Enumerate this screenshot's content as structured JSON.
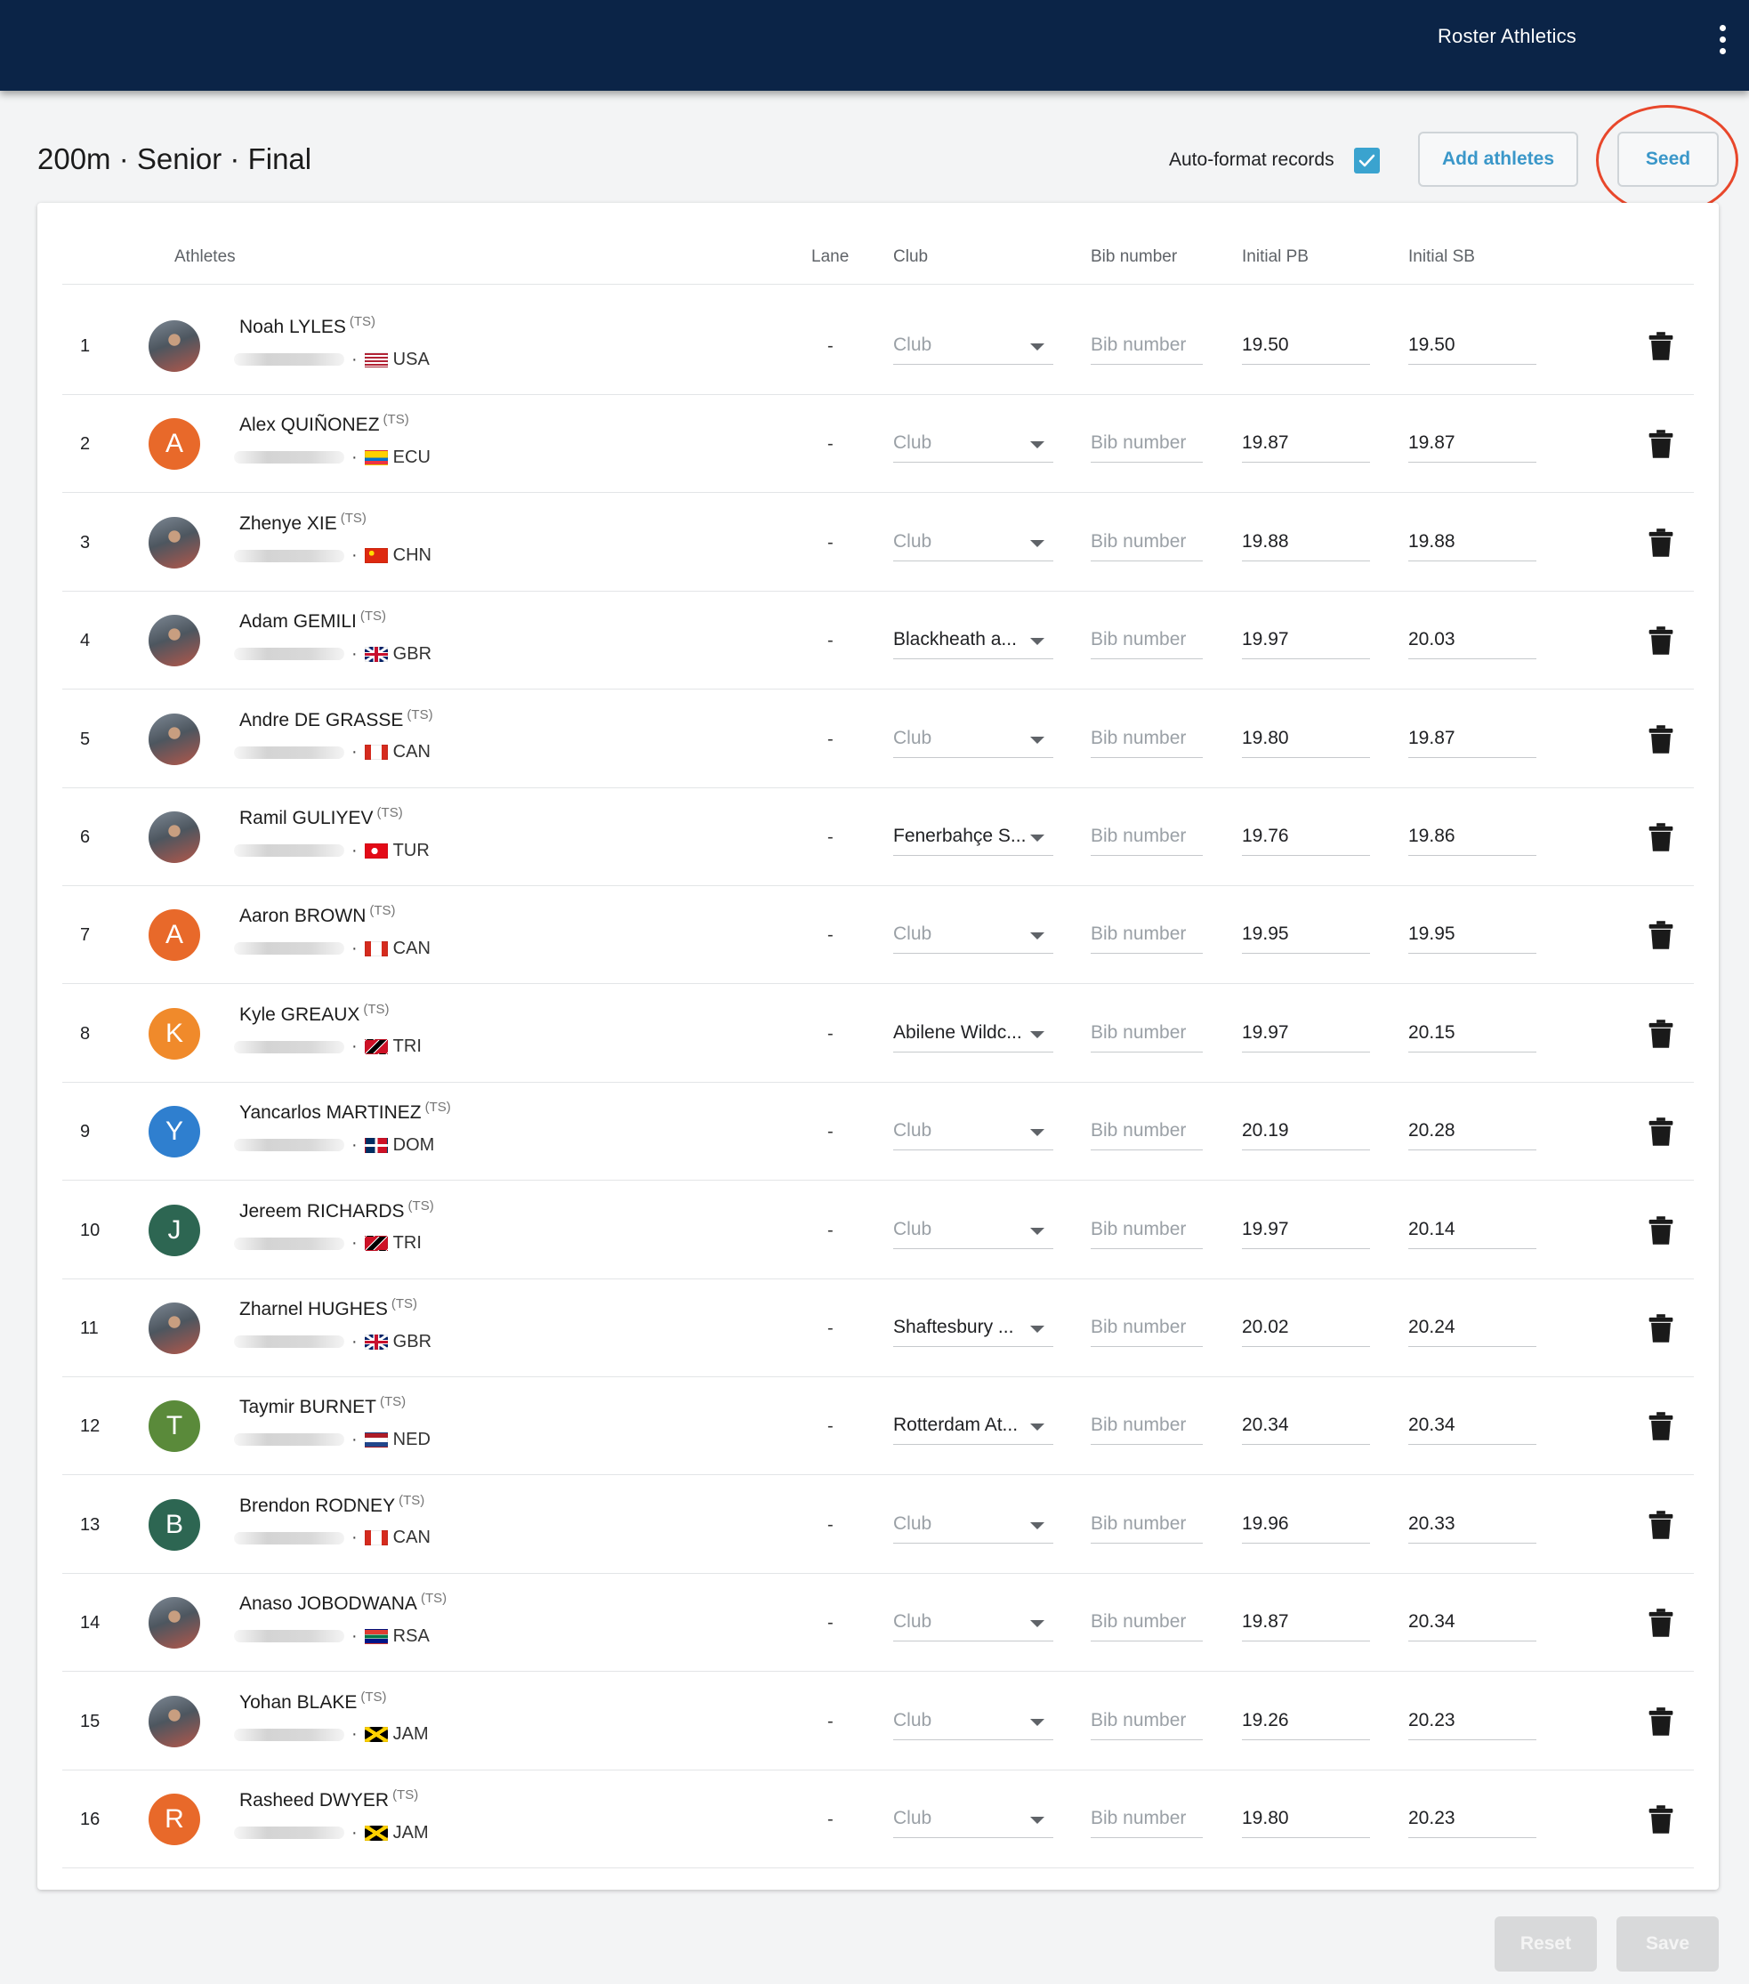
{
  "app": {
    "title": "Roster Athletics"
  },
  "page": {
    "title": "200m · Senior · Final",
    "autoformat_label": "Auto-format records",
    "autoformat_checked": true,
    "add_athletes_label": "Add athletes",
    "seed_label": "Seed",
    "reset_label": "Reset",
    "save_label": "Save"
  },
  "table": {
    "headers": {
      "athletes": "Athletes",
      "lane": "Lane",
      "club": "Club",
      "bib": "Bib number",
      "pb": "Initial PB",
      "sb": "Initial SB"
    },
    "club_placeholder": "Club",
    "bib_placeholder": "Bib number",
    "ts_tag": "(TS)",
    "rows": [
      {
        "index": "1",
        "name": "Noah LYLES",
        "country": "USA",
        "flag": "usa",
        "avatar_type": "photo",
        "avatar_letter": "",
        "avatar_color": "",
        "lane": "-",
        "club": "",
        "bib": "",
        "pb": "19.50",
        "sb": "19.50"
      },
      {
        "index": "2",
        "name": "Alex QUIÑONEZ",
        "country": "ECU",
        "flag": "ecu",
        "avatar_type": "letter",
        "avatar_letter": "A",
        "avatar_color": "#e8692a",
        "lane": "-",
        "club": "",
        "bib": "",
        "pb": "19.87",
        "sb": "19.87"
      },
      {
        "index": "3",
        "name": "Zhenye XIE",
        "country": "CHN",
        "flag": "chn",
        "avatar_type": "photo",
        "avatar_letter": "",
        "avatar_color": "",
        "lane": "-",
        "club": "",
        "bib": "",
        "pb": "19.88",
        "sb": "19.88"
      },
      {
        "index": "4",
        "name": "Adam GEMILI",
        "country": "GBR",
        "flag": "gbr",
        "avatar_type": "photo",
        "avatar_letter": "",
        "avatar_color": "",
        "lane": "-",
        "club": "Blackheath a...",
        "bib": "",
        "pb": "19.97",
        "sb": "20.03"
      },
      {
        "index": "5",
        "name": "Andre DE GRASSE",
        "country": "CAN",
        "flag": "can",
        "avatar_type": "photo",
        "avatar_letter": "",
        "avatar_color": "",
        "lane": "-",
        "club": "",
        "bib": "",
        "pb": "19.80",
        "sb": "19.87"
      },
      {
        "index": "6",
        "name": "Ramil GULIYEV",
        "country": "TUR",
        "flag": "tur",
        "avatar_type": "photo",
        "avatar_letter": "",
        "avatar_color": "",
        "lane": "-",
        "club": "Fenerbahçe S...",
        "bib": "",
        "pb": "19.76",
        "sb": "19.86"
      },
      {
        "index": "7",
        "name": "Aaron BROWN",
        "country": "CAN",
        "flag": "can",
        "avatar_type": "letter",
        "avatar_letter": "A",
        "avatar_color": "#e8692a",
        "lane": "-",
        "club": "",
        "bib": "",
        "pb": "19.95",
        "sb": "19.95"
      },
      {
        "index": "8",
        "name": "Kyle GREAUX",
        "country": "TRI",
        "flag": "tri",
        "avatar_type": "letter",
        "avatar_letter": "K",
        "avatar_color": "#f08a2b",
        "lane": "-",
        "club": "Abilene Wildc...",
        "bib": "",
        "pb": "19.97",
        "sb": "20.15"
      },
      {
        "index": "9",
        "name": "Yancarlos MARTINEZ",
        "country": "DOM",
        "flag": "dom",
        "avatar_type": "letter",
        "avatar_letter": "Y",
        "avatar_color": "#2f7fcf",
        "lane": "-",
        "club": "",
        "bib": "",
        "pb": "20.19",
        "sb": "20.28"
      },
      {
        "index": "10",
        "name": "Jereem RICHARDS",
        "country": "TRI",
        "flag": "tri",
        "avatar_type": "letter",
        "avatar_letter": "J",
        "avatar_color": "#2d6652",
        "lane": "-",
        "club": "",
        "bib": "",
        "pb": "19.97",
        "sb": "20.14"
      },
      {
        "index": "11",
        "name": "Zharnel HUGHES",
        "country": "GBR",
        "flag": "gbr",
        "avatar_type": "photo",
        "avatar_letter": "",
        "avatar_color": "",
        "lane": "-",
        "club": "Shaftesbury ...",
        "bib": "",
        "pb": "20.02",
        "sb": "20.24"
      },
      {
        "index": "12",
        "name": "Taymir BURNET",
        "country": "NED",
        "flag": "ned",
        "avatar_type": "letter",
        "avatar_letter": "T",
        "avatar_color": "#5a8a3a",
        "lane": "-",
        "club": "Rotterdam At...",
        "bib": "",
        "pb": "20.34",
        "sb": "20.34"
      },
      {
        "index": "13",
        "name": "Brendon RODNEY",
        "country": "CAN",
        "flag": "can",
        "avatar_type": "letter",
        "avatar_letter": "B",
        "avatar_color": "#2d6652",
        "lane": "-",
        "club": "",
        "bib": "",
        "pb": "19.96",
        "sb": "20.33"
      },
      {
        "index": "14",
        "name": "Anaso JOBODWANA",
        "country": "RSA",
        "flag": "rsa",
        "avatar_type": "photo",
        "avatar_letter": "",
        "avatar_color": "",
        "lane": "-",
        "club": "",
        "bib": "",
        "pb": "19.87",
        "sb": "20.34"
      },
      {
        "index": "15",
        "name": "Yohan BLAKE",
        "country": "JAM",
        "flag": "jam",
        "avatar_type": "photo",
        "avatar_letter": "",
        "avatar_color": "",
        "lane": "-",
        "club": "",
        "bib": "",
        "pb": "19.26",
        "sb": "20.23"
      },
      {
        "index": "16",
        "name": "Rasheed DWYER",
        "country": "JAM",
        "flag": "jam",
        "avatar_type": "letter",
        "avatar_letter": "R",
        "avatar_color": "#e8692a",
        "lane": "-",
        "club": "",
        "bib": "",
        "pb": "19.80",
        "sb": "20.23"
      }
    ]
  },
  "colors": {
    "appbar": "#0b2447",
    "accent": "#3aa3cf",
    "annotation": "#e8472b"
  },
  "icons": {
    "menu": "kebab-menu-icon",
    "checkbox": "checkmark-icon",
    "delete": "trash-icon",
    "dropdown": "chevron-down-icon"
  }
}
